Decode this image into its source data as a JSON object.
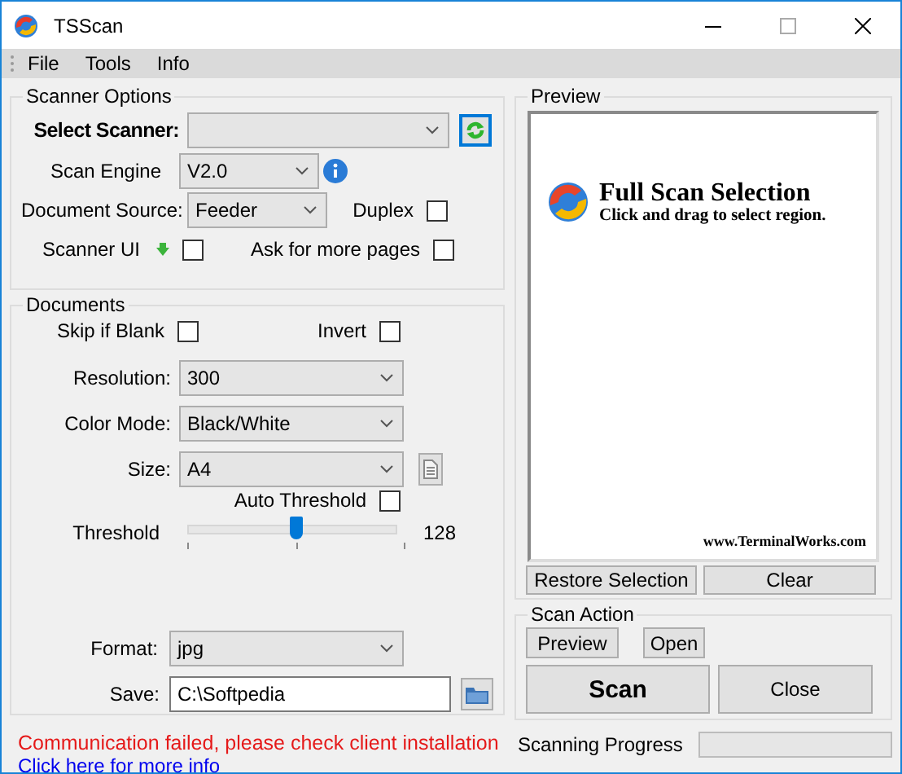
{
  "window": {
    "title": "TSScan"
  },
  "menu": [
    {
      "label": "File"
    },
    {
      "label": "Tools"
    },
    {
      "label": "Info"
    }
  ],
  "scanner_options": {
    "title": "Scanner Options",
    "select_scanner": {
      "label": "Select Scanner:"
    },
    "scan_engine": {
      "label": "Scan Engine",
      "value": "V2.0"
    },
    "document_source": {
      "label": "Document Source:",
      "value": "Feeder"
    },
    "duplex": {
      "label": "Duplex",
      "checked": false
    },
    "scanner_ui": {
      "label": "Scanner UI",
      "checked": false
    },
    "ask_more_pages": {
      "label": "Ask for more pages",
      "checked": false
    }
  },
  "documents": {
    "title": "Documents",
    "skip_if_blank": {
      "label": "Skip if Blank",
      "checked": false
    },
    "invert": {
      "label": "Invert",
      "checked": false
    },
    "resolution": {
      "label": "Resolution:",
      "value": "300"
    },
    "color_mode": {
      "label": "Color Mode:",
      "value": "Black/White"
    },
    "size": {
      "label": "Size:",
      "value": "A4"
    },
    "auto_threshold": {
      "label": "Auto Threshold",
      "checked": false
    },
    "threshold": {
      "label": "Threshold",
      "level": 0.5,
      "reading": "128"
    },
    "format": {
      "label": "Format:",
      "value": "jpg"
    },
    "save": {
      "label": "Save:",
      "value": "C:\\Softpedia"
    }
  },
  "status": {
    "error": "Communication failed, please check client installation",
    "link": "Click here for more info"
  },
  "preview": {
    "title": "Preview",
    "heading": "Full Scan Selection",
    "hint": "Click and drag to select region.",
    "url": "www.TerminalWorks.com",
    "buttons": [
      "Restore Selection",
      "Clear"
    ]
  },
  "scan_action": {
    "title": "Scan Action",
    "preview_button": "Preview",
    "open_button": "Open",
    "scan_button": "Scan",
    "close_button": "Close"
  },
  "progress": {
    "label": "Scanning Progress",
    "level": 0
  }
}
